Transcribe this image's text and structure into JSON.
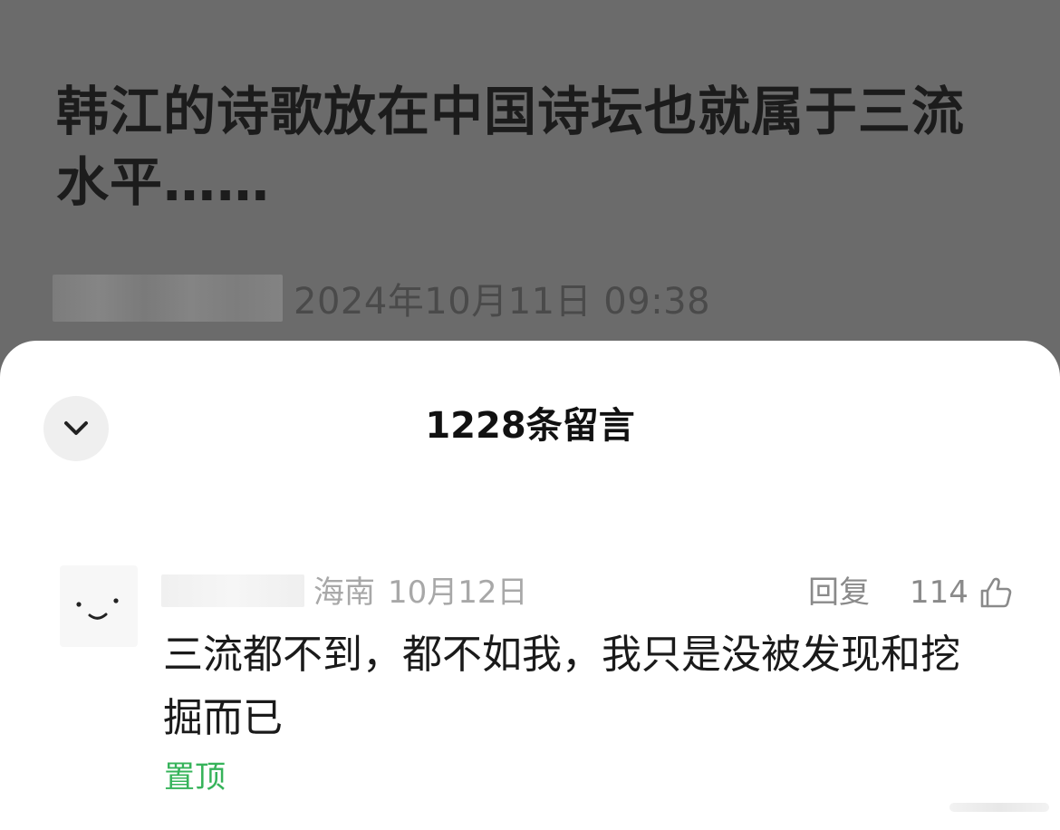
{
  "article": {
    "title": "韩江的诗歌放在中国诗坛也就属于三流水平……",
    "publish_time": "2024年10月11日 09:38"
  },
  "comments_panel": {
    "title": "1228条留言",
    "collapse_icon": "chevron-down-icon"
  },
  "comment": {
    "location": "海南",
    "date": "10月12日",
    "reply_label": "回复",
    "like_count": "114",
    "like_icon": "thumbs-up-icon",
    "avatar_icon": "smiley-face-icon",
    "text": "三流都不到，都不如我，我只是没被发现和挖掘而已",
    "pinned_label": "置顶"
  },
  "colors": {
    "overlay_bg": "#6b6b6b",
    "pinned_green": "#36b35a",
    "muted_text": "#a8a8a8"
  }
}
